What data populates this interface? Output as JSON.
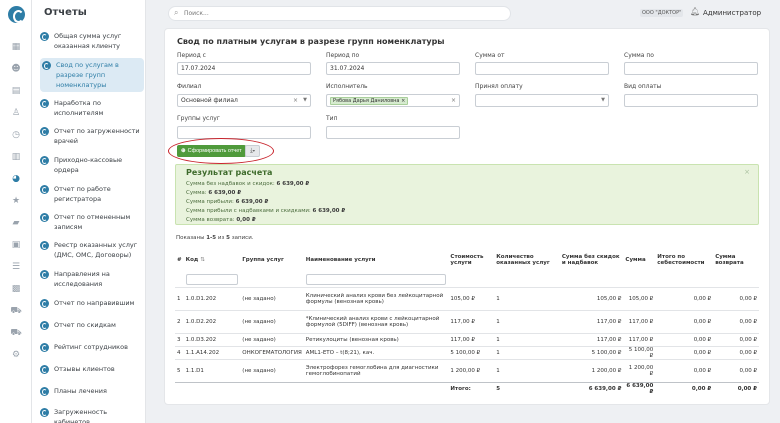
{
  "sidebar": {
    "title": "Отчеты",
    "collapse_icon": "chevron-left-icon",
    "items": [
      {
        "label": "Общая сумма услуг оказанная клиенту"
      },
      {
        "label": "Свод по услугам в разрезе групп номенклатуры"
      },
      {
        "label": "Наработка по исполнителям"
      },
      {
        "label": "Отчет по загруженности врачей"
      },
      {
        "label": "Приходно-кассовые ордера"
      },
      {
        "label": "Отчет по работе регистратора"
      },
      {
        "label": "Отчет по отмененным записям"
      },
      {
        "label": "Реестр оказанных услуг (ДМС, ОМС, Договоры)"
      },
      {
        "label": "Направления на исследования"
      },
      {
        "label": "Отчет по направившим"
      },
      {
        "label": "Отчет по скидкам"
      },
      {
        "label": "Рейтинг сотрудников"
      },
      {
        "label": "Отзывы клиентов"
      },
      {
        "label": "Планы лечения"
      },
      {
        "label": "Загруженность кабинетов"
      }
    ]
  },
  "rail_icons": [
    "calendar-icon",
    "users-icon",
    "clipboard-icon",
    "user-icon",
    "clock-icon",
    "table-icon",
    "reports-icon",
    "star-icon",
    "chat-icon",
    "wallet-icon",
    "list-icon",
    "store-icon",
    "cart-icon",
    "cart2-icon",
    "gear-icon"
  ],
  "topbar": {
    "search_placeholder": "Поиск...",
    "org": "ООО \"ДОКТОР\"",
    "user": "Администратор"
  },
  "form": {
    "title": "Свод по платным услугам в разрезе групп номенклатуры",
    "period_from_label": "Период с",
    "period_from_value": "17.07.2024",
    "period_to_label": "Период по",
    "period_to_value": "31.07.2024",
    "sum_from_label": "Сумма от",
    "sum_to_label": "Сумма по",
    "branch_label": "Филиал",
    "branch_value": "Основной филиал",
    "executor_label": "Исполнитель",
    "executor_tag": "Рябова Дарья Даниловна",
    "accepted_label": "Принял оплату",
    "payment_label": "Вид оплаты",
    "groups_label": "Группы услуг",
    "type_label": "Тип",
    "generate_button": "Сформировать отчет"
  },
  "result": {
    "title": "Результат расчета",
    "lines": [
      {
        "label": "Сумма без надбавок и скидок:",
        "value": "6 639,00 ₽"
      },
      {
        "label": "Сумма:",
        "value": "6 639,00 ₽"
      },
      {
        "label": "Сумма прибыли:",
        "value": "6 639,00 ₽"
      },
      {
        "label": "Сумма прибыли с надбавками и скидками:",
        "value": "6 639,00 ₽"
      },
      {
        "label": "Сумма возврата:",
        "value": "0,00 ₽"
      }
    ]
  },
  "table": {
    "shown_prefix": "Показаны ",
    "shown_range": "1-5",
    "shown_mid": " из ",
    "shown_total": "5",
    "shown_suffix": " записи.",
    "headers": [
      "#",
      "Код",
      "Группа услуг",
      "Наименование услуги",
      "Стоимость услуги",
      "Количество оказанных услуг",
      "Сумма без скидок и надбавок",
      "Сумма",
      "Итого по себестоимости",
      "Сумма возврата"
    ],
    "rows": [
      {
        "n": "1",
        "code": "1.0.D1.202",
        "group": "(не задано)",
        "name": "Клинический анализ крови без лейкоцитарной формулы (венозная кровь)",
        "price": "105,00 ₽",
        "qty": "1",
        "sum_nd": "105,00 ₽",
        "sum": "105,00 ₽",
        "cost": "0,00 ₽",
        "ret": "0,00 ₽",
        "tall": true
      },
      {
        "n": "2",
        "code": "1.0.D2.202",
        "group": "(не задано)",
        "name": "*Клинический анализ крови с лейкоцитарной формулой (5DIFF) (венозная кровь)",
        "price": "117,00 ₽",
        "qty": "1",
        "sum_nd": "117,00 ₽",
        "sum": "117,00 ₽",
        "cost": "0,00 ₽",
        "ret": "0,00 ₽",
        "tall": true
      },
      {
        "n": "3",
        "code": "1.0.D3.202",
        "group": "(не задано)",
        "name": "Ретикулоциты (венозная кровь)",
        "price": "117,00 ₽",
        "qty": "1",
        "sum_nd": "117,00 ₽",
        "sum": "117,00 ₽",
        "cost": "0,00 ₽",
        "ret": "0,00 ₽",
        "tall": false
      },
      {
        "n": "4",
        "code": "1.1.A14.202",
        "group": "ОНКОГЕМАТОЛОГИЯ",
        "name": "AML1-ETO – t(8;21), кач.",
        "price": "5 100,00 ₽",
        "qty": "1",
        "sum_nd": "5 100,00 ₽",
        "sum": "5 100,00 ₽",
        "cost": "0,00 ₽",
        "ret": "0,00 ₽",
        "tall": false
      },
      {
        "n": "5",
        "code": "1.1.D1",
        "group": "(не задано)",
        "name": "Электрофорез гемоглобина для диагностики гемоглобинопатий",
        "price": "1 200,00 ₽",
        "qty": "1",
        "sum_nd": "1 200,00 ₽",
        "sum": "1 200,00 ₽",
        "cost": "0,00 ₽",
        "ret": "0,00 ₽",
        "tall": true
      }
    ],
    "total": {
      "label": "Итого:",
      "qty": "5",
      "sum_nd": "6 639,00 ₽",
      "sum": "6 639,00 ₽",
      "cost": "0,00 ₽",
      "ret": "0,00 ₽"
    }
  }
}
